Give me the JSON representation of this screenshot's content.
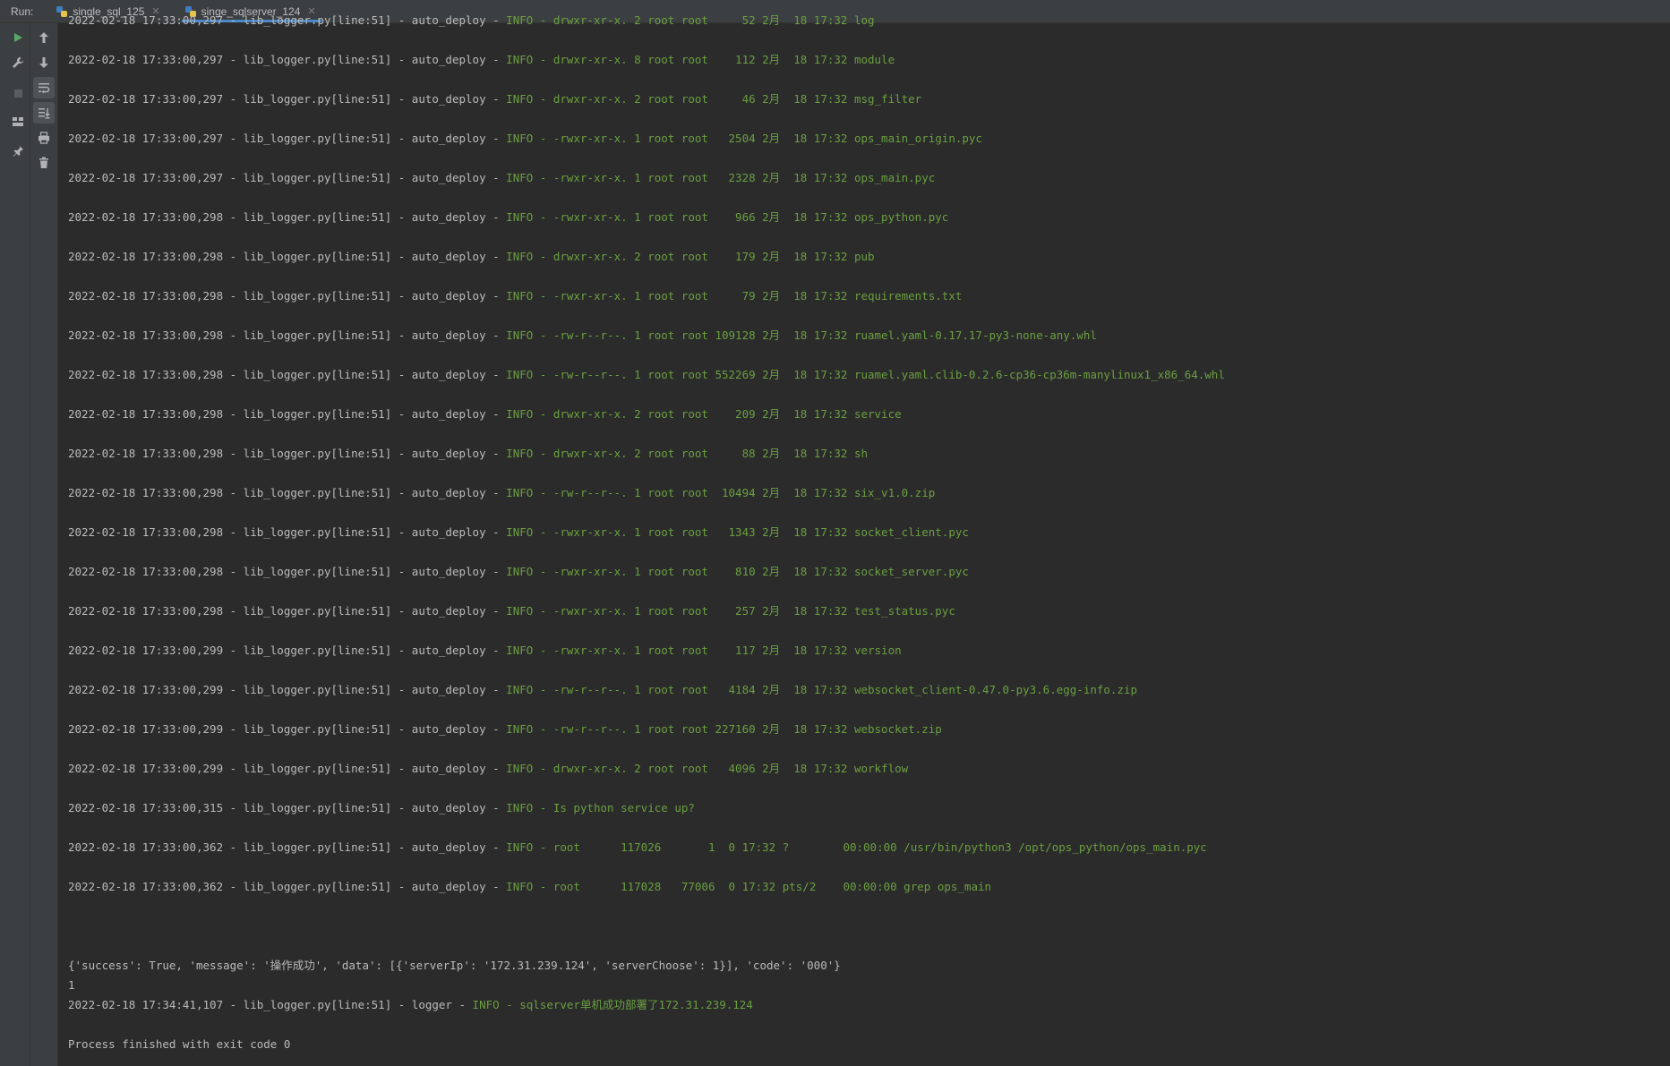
{
  "run_label": "Run:",
  "tabs": [
    {
      "label": "single_sql_125",
      "active": false
    },
    {
      "label": "singe_sqlserver_124",
      "active": true
    }
  ],
  "toolbar": {
    "col1": [
      "run-icon",
      "wrench-icon",
      "stop-icon",
      "layout-icon",
      "pin-icon"
    ],
    "col2": [
      "arrow-up-icon",
      "arrow-down-icon",
      "soft-wrap-icon",
      "scroll-to-end-icon",
      "print-icon",
      "trash-icon"
    ]
  },
  "colors": {
    "info": "#6a9f41",
    "text": "#bbbbbb",
    "background": "#2b2b2b"
  },
  "log": [
    {
      "prefix": "2022-02-18 17:33:00,297 - lib_logger.py[line:51] - auto_deploy - ",
      "info": "INFO - drwxr-xr-x. 2 root root     52 2月  18 17:32 log"
    },
    {
      "prefix": "2022-02-18 17:33:00,297 - lib_logger.py[line:51] - auto_deploy - ",
      "info": "INFO - drwxr-xr-x. 8 root root    112 2月  18 17:32 module"
    },
    {
      "prefix": "2022-02-18 17:33:00,297 - lib_logger.py[line:51] - auto_deploy - ",
      "info": "INFO - drwxr-xr-x. 2 root root     46 2月  18 17:32 msg_filter"
    },
    {
      "prefix": "2022-02-18 17:33:00,297 - lib_logger.py[line:51] - auto_deploy - ",
      "info": "INFO - -rwxr-xr-x. 1 root root   2504 2月  18 17:32 ops_main_origin.pyc"
    },
    {
      "prefix": "2022-02-18 17:33:00,297 - lib_logger.py[line:51] - auto_deploy - ",
      "info": "INFO - -rwxr-xr-x. 1 root root   2328 2月  18 17:32 ops_main.pyc"
    },
    {
      "prefix": "2022-02-18 17:33:00,298 - lib_logger.py[line:51] - auto_deploy - ",
      "info": "INFO - -rwxr-xr-x. 1 root root    966 2月  18 17:32 ops_python.pyc"
    },
    {
      "prefix": "2022-02-18 17:33:00,298 - lib_logger.py[line:51] - auto_deploy - ",
      "info": "INFO - drwxr-xr-x. 2 root root    179 2月  18 17:32 pub"
    },
    {
      "prefix": "2022-02-18 17:33:00,298 - lib_logger.py[line:51] - auto_deploy - ",
      "info": "INFO - -rwxr-xr-x. 1 root root     79 2月  18 17:32 requirements.txt"
    },
    {
      "prefix": "2022-02-18 17:33:00,298 - lib_logger.py[line:51] - auto_deploy - ",
      "info": "INFO - -rw-r--r--. 1 root root 109128 2月  18 17:32 ruamel.yaml-0.17.17-py3-none-any.whl"
    },
    {
      "prefix": "2022-02-18 17:33:00,298 - lib_logger.py[line:51] - auto_deploy - ",
      "info": "INFO - -rw-r--r--. 1 root root 552269 2月  18 17:32 ruamel.yaml.clib-0.2.6-cp36-cp36m-manylinux1_x86_64.whl"
    },
    {
      "prefix": "2022-02-18 17:33:00,298 - lib_logger.py[line:51] - auto_deploy - ",
      "info": "INFO - drwxr-xr-x. 2 root root    209 2月  18 17:32 service"
    },
    {
      "prefix": "2022-02-18 17:33:00,298 - lib_logger.py[line:51] - auto_deploy - ",
      "info": "INFO - drwxr-xr-x. 2 root root     88 2月  18 17:32 sh"
    },
    {
      "prefix": "2022-02-18 17:33:00,298 - lib_logger.py[line:51] - auto_deploy - ",
      "info": "INFO - -rw-r--r--. 1 root root  10494 2月  18 17:32 six_v1.0.zip"
    },
    {
      "prefix": "2022-02-18 17:33:00,298 - lib_logger.py[line:51] - auto_deploy - ",
      "info": "INFO - -rwxr-xr-x. 1 root root   1343 2月  18 17:32 socket_client.pyc"
    },
    {
      "prefix": "2022-02-18 17:33:00,298 - lib_logger.py[line:51] - auto_deploy - ",
      "info": "INFO - -rwxr-xr-x. 1 root root    810 2月  18 17:32 socket_server.pyc"
    },
    {
      "prefix": "2022-02-18 17:33:00,298 - lib_logger.py[line:51] - auto_deploy - ",
      "info": "INFO - -rwxr-xr-x. 1 root root    257 2月  18 17:32 test_status.pyc"
    },
    {
      "prefix": "2022-02-18 17:33:00,299 - lib_logger.py[line:51] - auto_deploy - ",
      "info": "INFO - -rwxr-xr-x. 1 root root    117 2月  18 17:32 version"
    },
    {
      "prefix": "2022-02-18 17:33:00,299 - lib_logger.py[line:51] - auto_deploy - ",
      "info": "INFO - -rw-r--r--. 1 root root   4184 2月  18 17:32 websocket_client-0.47.0-py3.6.egg-info.zip"
    },
    {
      "prefix": "2022-02-18 17:33:00,299 - lib_logger.py[line:51] - auto_deploy - ",
      "info": "INFO - -rw-r--r--. 1 root root 227160 2月  18 17:32 websocket.zip"
    },
    {
      "prefix": "2022-02-18 17:33:00,299 - lib_logger.py[line:51] - auto_deploy - ",
      "info": "INFO - drwxr-xr-x. 2 root root   4096 2月  18 17:32 workflow"
    },
    {
      "prefix": "2022-02-18 17:33:00,315 - lib_logger.py[line:51] - auto_deploy - ",
      "info": "INFO - Is python service up?"
    },
    {
      "prefix": "2022-02-18 17:33:00,362 - lib_logger.py[line:51] - auto_deploy - ",
      "info": "INFO - root      117026       1  0 17:32 ?        00:00:00 /usr/bin/python3 /opt/ops_python/ops_main.pyc"
    },
    {
      "prefix": "2022-02-18 17:33:00,362 - lib_logger.py[line:51] - auto_deploy - ",
      "info": "INFO - root      117028   77006  0 17:32 pts/2    00:00:00 grep ops_main"
    }
  ],
  "result_line": "{'success': True, 'message': '操作成功', 'data': [{'serverIp': '172.31.239.124', 'serverChoose': 1}], 'code': '000'}",
  "count_line": "1",
  "final_log": {
    "prefix": "2022-02-18 17:34:41,107 - lib_logger.py[line:51] - logger - ",
    "info": "INFO - sqlserver单机成功部署了172.31.239.124"
  },
  "exit_line": "Process finished with exit code 0"
}
